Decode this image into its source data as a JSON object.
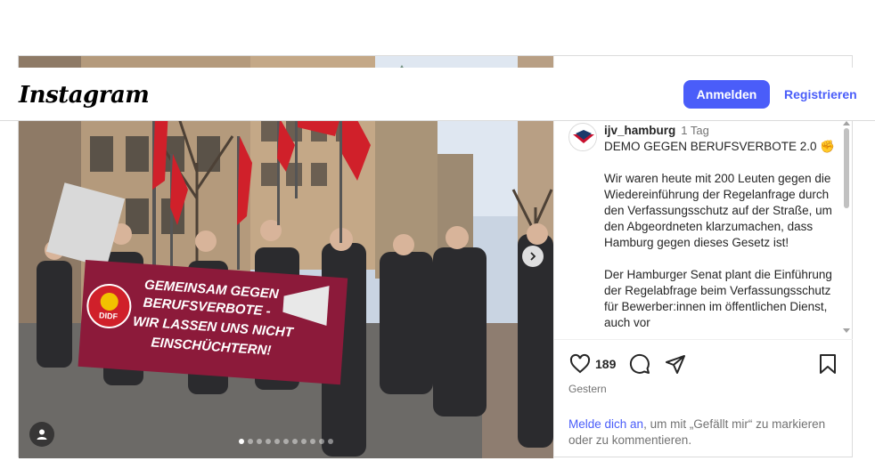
{
  "nav": {
    "logo": "Instagram",
    "login_label": "Anmelden",
    "register_label": "Registrieren"
  },
  "photo": {
    "banner_line1": "GEMEINSAM GEGEN",
    "banner_line2": "BERUFSVERBOTE -",
    "banner_line3": "WIR LASSEN UNS NICHT",
    "banner_line4": "EINSCHÜCHTERN!",
    "banner_logo": "DIDF",
    "carousel_slide_count": 11,
    "carousel_active_index": 0
  },
  "post": {
    "username": "ijv_hamburg",
    "time": "1 Tag",
    "caption": "DEMO GEGEN BERUFSVERBOTE 2.0 ✊\n\nWir waren heute mit 200 Leuten gegen die Wiedereinführung der Regelanfrage durch den Verfassungsschutz auf der Straße, um den Abgeordneten klarzumachen, dass Hamburg gegen dieses Gesetz ist!\n\nDer Hamburger Senat plant die Einführung der Regelabfrage beim Verfassungsschutz für Bewerber:innen im öffentlichen Dienst, auch vor",
    "likes": "189",
    "date": "Gestern",
    "login_link": "Melde dich an",
    "login_rest": ", um mit „Gefällt mir“ zu markieren oder zu kommentieren."
  },
  "icons": {
    "like": "heart-icon",
    "comment": "comment-icon",
    "share": "send-icon",
    "save": "bookmark-icon",
    "next": "chevron-right-icon",
    "tag": "user-tag-icon"
  },
  "colors": {
    "accent": "#4a5df9",
    "banner": "#8c1a3a",
    "flag": "#d0202a"
  }
}
